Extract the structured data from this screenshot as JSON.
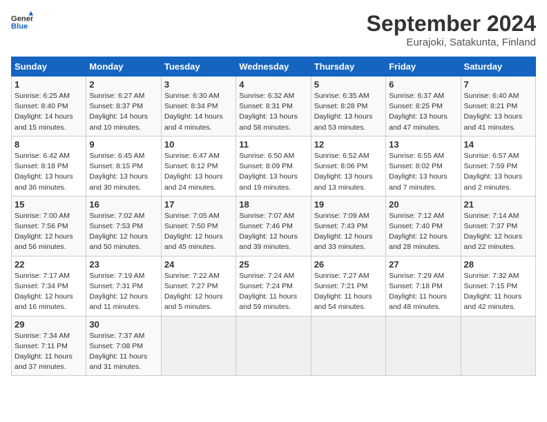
{
  "header": {
    "logo_line1": "General",
    "logo_line2": "Blue",
    "title": "September 2024",
    "subtitle": "Eurajoki, Satakunta, Finland"
  },
  "calendar": {
    "weekdays": [
      "Sunday",
      "Monday",
      "Tuesday",
      "Wednesday",
      "Thursday",
      "Friday",
      "Saturday"
    ],
    "weeks": [
      [
        {
          "day": "1",
          "info": "Sunrise: 6:25 AM\nSunset: 8:40 PM\nDaylight: 14 hours\nand 15 minutes."
        },
        {
          "day": "2",
          "info": "Sunrise: 6:27 AM\nSunset: 8:37 PM\nDaylight: 14 hours\nand 10 minutes."
        },
        {
          "day": "3",
          "info": "Sunrise: 6:30 AM\nSunset: 8:34 PM\nDaylight: 14 hours\nand 4 minutes."
        },
        {
          "day": "4",
          "info": "Sunrise: 6:32 AM\nSunset: 8:31 PM\nDaylight: 13 hours\nand 58 minutes."
        },
        {
          "day": "5",
          "info": "Sunrise: 6:35 AM\nSunset: 8:28 PM\nDaylight: 13 hours\nand 53 minutes."
        },
        {
          "day": "6",
          "info": "Sunrise: 6:37 AM\nSunset: 8:25 PM\nDaylight: 13 hours\nand 47 minutes."
        },
        {
          "day": "7",
          "info": "Sunrise: 6:40 AM\nSunset: 8:21 PM\nDaylight: 13 hours\nand 41 minutes."
        }
      ],
      [
        {
          "day": "8",
          "info": "Sunrise: 6:42 AM\nSunset: 8:18 PM\nDaylight: 13 hours\nand 36 minutes."
        },
        {
          "day": "9",
          "info": "Sunrise: 6:45 AM\nSunset: 8:15 PM\nDaylight: 13 hours\nand 30 minutes."
        },
        {
          "day": "10",
          "info": "Sunrise: 6:47 AM\nSunset: 8:12 PM\nDaylight: 13 hours\nand 24 minutes."
        },
        {
          "day": "11",
          "info": "Sunrise: 6:50 AM\nSunset: 8:09 PM\nDaylight: 13 hours\nand 19 minutes."
        },
        {
          "day": "12",
          "info": "Sunrise: 6:52 AM\nSunset: 8:06 PM\nDaylight: 13 hours\nand 13 minutes."
        },
        {
          "day": "13",
          "info": "Sunrise: 6:55 AM\nSunset: 8:02 PM\nDaylight: 13 hours\nand 7 minutes."
        },
        {
          "day": "14",
          "info": "Sunrise: 6:57 AM\nSunset: 7:59 PM\nDaylight: 13 hours\nand 2 minutes."
        }
      ],
      [
        {
          "day": "15",
          "info": "Sunrise: 7:00 AM\nSunset: 7:56 PM\nDaylight: 12 hours\nand 56 minutes."
        },
        {
          "day": "16",
          "info": "Sunrise: 7:02 AM\nSunset: 7:53 PM\nDaylight: 12 hours\nand 50 minutes."
        },
        {
          "day": "17",
          "info": "Sunrise: 7:05 AM\nSunset: 7:50 PM\nDaylight: 12 hours\nand 45 minutes."
        },
        {
          "day": "18",
          "info": "Sunrise: 7:07 AM\nSunset: 7:46 PM\nDaylight: 12 hours\nand 39 minutes."
        },
        {
          "day": "19",
          "info": "Sunrise: 7:09 AM\nSunset: 7:43 PM\nDaylight: 12 hours\nand 33 minutes."
        },
        {
          "day": "20",
          "info": "Sunrise: 7:12 AM\nSunset: 7:40 PM\nDaylight: 12 hours\nand 28 minutes."
        },
        {
          "day": "21",
          "info": "Sunrise: 7:14 AM\nSunset: 7:37 PM\nDaylight: 12 hours\nand 22 minutes."
        }
      ],
      [
        {
          "day": "22",
          "info": "Sunrise: 7:17 AM\nSunset: 7:34 PM\nDaylight: 12 hours\nand 16 minutes."
        },
        {
          "day": "23",
          "info": "Sunrise: 7:19 AM\nSunset: 7:31 PM\nDaylight: 12 hours\nand 11 minutes."
        },
        {
          "day": "24",
          "info": "Sunrise: 7:22 AM\nSunset: 7:27 PM\nDaylight: 12 hours\nand 5 minutes."
        },
        {
          "day": "25",
          "info": "Sunrise: 7:24 AM\nSunset: 7:24 PM\nDaylight: 11 hours\nand 59 minutes."
        },
        {
          "day": "26",
          "info": "Sunrise: 7:27 AM\nSunset: 7:21 PM\nDaylight: 11 hours\nand 54 minutes."
        },
        {
          "day": "27",
          "info": "Sunrise: 7:29 AM\nSunset: 7:18 PM\nDaylight: 11 hours\nand 48 minutes."
        },
        {
          "day": "28",
          "info": "Sunrise: 7:32 AM\nSunset: 7:15 PM\nDaylight: 11 hours\nand 42 minutes."
        }
      ],
      [
        {
          "day": "29",
          "info": "Sunrise: 7:34 AM\nSunset: 7:11 PM\nDaylight: 11 hours\nand 37 minutes."
        },
        {
          "day": "30",
          "info": "Sunrise: 7:37 AM\nSunset: 7:08 PM\nDaylight: 11 hours\nand 31 minutes."
        },
        {
          "day": "",
          "info": ""
        },
        {
          "day": "",
          "info": ""
        },
        {
          "day": "",
          "info": ""
        },
        {
          "day": "",
          "info": ""
        },
        {
          "day": "",
          "info": ""
        }
      ]
    ]
  }
}
